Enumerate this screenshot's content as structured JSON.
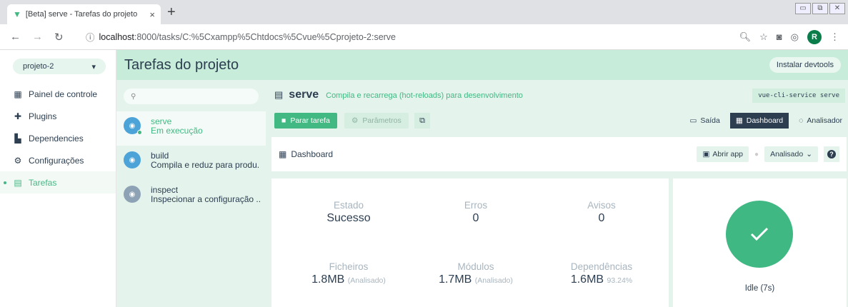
{
  "browser": {
    "tab_title": "[Beta] serve - Tarefas do projeto",
    "tab_close": "×",
    "new_tab": "+",
    "url_host": "localhost",
    "url_path": ":8000/tasks/C:%5Cxampp%5Chtdocs%5Cvue%5Cprojeto-2:serve",
    "profile_initial": "R"
  },
  "sidebar": {
    "project_selector": "projeto-2",
    "items": [
      {
        "label": "Painel de controle",
        "icon": "dashboard-icon"
      },
      {
        "label": "Plugins",
        "icon": "puzzle-icon"
      },
      {
        "label": "Dependencies",
        "icon": "library-icon"
      },
      {
        "label": "Configurações",
        "icon": "settings-icon"
      },
      {
        "label": "Tarefas",
        "icon": "tasks-icon",
        "active": true
      }
    ]
  },
  "header": {
    "title": "Tarefas do projeto",
    "devtools_button": "Instalar devtools"
  },
  "tasks": {
    "search_placeholder": "",
    "items": [
      {
        "name": "serve",
        "desc": "Em execução",
        "selected": true
      },
      {
        "name": "build",
        "desc": "Compila e reduz para produ..."
      },
      {
        "name": "inspect",
        "desc": "Inspecionar a configuração ..."
      }
    ]
  },
  "task_detail": {
    "name": "serve",
    "description": "Compila e recarrega (hot-reloads) para desenvolvimento",
    "command": "vue-cli-service serve",
    "stop_button": "Parar tarefa",
    "params_button": "Parâmetros",
    "tabs": {
      "output": "Saída",
      "dashboard": "Dashboard",
      "analyzer": "Analisador"
    }
  },
  "dashboard": {
    "title": "Dashboard",
    "open_app": "Abrir app",
    "mode_select": "Analisado",
    "help": "?",
    "stats": {
      "status_label": "Estado",
      "status_value": "Sucesso",
      "errors_label": "Erros",
      "errors_value": "0",
      "warnings_label": "Avisos",
      "warnings_value": "0",
      "files_label": "Ficheiros",
      "files_value": "1.8MB",
      "files_sub": "(Analisado)",
      "modules_label": "Módulos",
      "modules_value": "1.7MB",
      "modules_sub": "(Analisado)",
      "deps_label": "Dependências",
      "deps_value": "1.6MB",
      "deps_sub": "93.24%"
    },
    "idle_text": "Idle (7s)"
  },
  "colors": {
    "accent": "#42b883",
    "dark": "#2c3e50",
    "panel": "#e4f4ec",
    "topbar": "#c7ecd9"
  }
}
